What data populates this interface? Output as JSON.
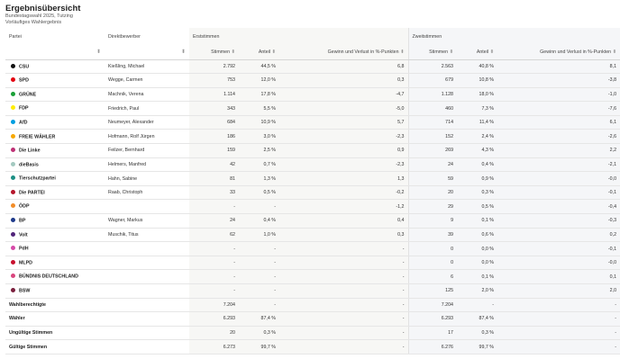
{
  "header": {
    "title": "Ergebnisübersicht",
    "subtitle": "Bundestagswahl 2025, Tutzing",
    "status": "Vorläufiges Wahlergebnis"
  },
  "columns": {
    "partei": "Partei",
    "direktbewerber": "Direktbewerber",
    "erststimmen": "Erststimmen",
    "zweitstimmen": "Zweitstimmen",
    "stimmen": "Stimmen",
    "anteil": "Anteil",
    "gewinn": "Gewinn und Verlust in %-Punkten"
  },
  "parties": [
    {
      "party": "CSU",
      "color": "#111111",
      "candidate": "Kießling, Michael",
      "e_votes": "2.792",
      "e_share": "44,5 %",
      "e_delta": "6,8",
      "z_votes": "2.563",
      "z_share": "40,8 %",
      "z_delta": "8,1"
    },
    {
      "party": "SPD",
      "color": "#e3000f",
      "candidate": "Wegge, Carmen",
      "e_votes": "753",
      "e_share": "12,0 %",
      "e_delta": "0,3",
      "z_votes": "679",
      "z_share": "10,8 %",
      "z_delta": "-3,8"
    },
    {
      "party": "GRÜNE",
      "color": "#1aa037",
      "candidate": "Machnik, Verena",
      "e_votes": "1.114",
      "e_share": "17,8 %",
      "e_delta": "-4,7",
      "z_votes": "1.128",
      "z_share": "18,0 %",
      "z_delta": "-1,0"
    },
    {
      "party": "FDP",
      "color": "#ffed00",
      "candidate": "Friedrich, Paul",
      "e_votes": "343",
      "e_share": "5,5 %",
      "e_delta": "-5,0",
      "z_votes": "460",
      "z_share": "7,3 %",
      "z_delta": "-7,6"
    },
    {
      "party": "AfD",
      "color": "#009ee0",
      "candidate": "Neumeyer, Alexander",
      "e_votes": "684",
      "e_share": "10,9 %",
      "e_delta": "5,7",
      "z_votes": "714",
      "z_share": "11,4 %",
      "z_delta": "6,1"
    },
    {
      "party": "FREIE WÄHLER",
      "color": "#f7a800",
      "candidate": "Hofmann, Rolf Jürgen",
      "e_votes": "186",
      "e_share": "3,0 %",
      "e_delta": "-2,3",
      "z_votes": "152",
      "z_share": "2,4 %",
      "z_delta": "-2,6"
    },
    {
      "party": "Die Linke",
      "color": "#be3075",
      "candidate": "Feilzer, Bernhard",
      "e_votes": "159",
      "e_share": "2,5 %",
      "e_delta": "0,9",
      "z_votes": "269",
      "z_share": "4,3 %",
      "z_delta": "2,2"
    },
    {
      "party": "dieBasis",
      "color": "#a3c9c0",
      "candidate": "Helmers, Manfred",
      "e_votes": "42",
      "e_share": "0,7 %",
      "e_delta": "-2,3",
      "z_votes": "24",
      "z_share": "0,4 %",
      "z_delta": "-2,1"
    },
    {
      "party": "Tierschutzpartei",
      "color": "#1c8f84",
      "candidate": "Hahn, Sabine",
      "e_votes": "81",
      "e_share": "1,3 %",
      "e_delta": "1,3",
      "z_votes": "59",
      "z_share": "0,9 %",
      "z_delta": "-0,0"
    },
    {
      "party": "Die PARTEI",
      "color": "#b5152b",
      "candidate": "Raab, Christoph",
      "e_votes": "33",
      "e_share": "0,5 %",
      "e_delta": "-0,2",
      "z_votes": "20",
      "z_share": "0,3 %",
      "z_delta": "-0,1"
    },
    {
      "party": "ÖDP",
      "color": "#f28c28",
      "candidate": "",
      "e_votes": "-",
      "e_share": "-",
      "e_delta": "-1,2",
      "z_votes": "29",
      "z_share": "0,5 %",
      "z_delta": "-0,4"
    },
    {
      "party": "BP",
      "color": "#1e3a8a",
      "candidate": "Wagner, Markus",
      "e_votes": "24",
      "e_share": "0,4 %",
      "e_delta": "0,4",
      "z_votes": "9",
      "z_share": "0,1 %",
      "z_delta": "-0,3"
    },
    {
      "party": "Volt",
      "color": "#502379",
      "candidate": "Muschik, Titus",
      "e_votes": "62",
      "e_share": "1,0 %",
      "e_delta": "0,3",
      "z_votes": "39",
      "z_share": "0,6 %",
      "z_delta": "0,2"
    },
    {
      "party": "PdH",
      "color": "#d64aa8",
      "candidate": "",
      "e_votes": "-",
      "e_share": "-",
      "e_delta": "-",
      "z_votes": "0",
      "z_share": "0,0 %",
      "z_delta": "-0,1"
    },
    {
      "party": "MLPD",
      "color": "#c8102e",
      "candidate": "",
      "e_votes": "-",
      "e_share": "-",
      "e_delta": "-",
      "z_votes": "0",
      "z_share": "0,0 %",
      "z_delta": "-0,0"
    },
    {
      "party": "BÜNDNIS DEUTSCHLAND",
      "color": "#d9467e",
      "candidate": "",
      "e_votes": "-",
      "e_share": "-",
      "e_delta": "-",
      "z_votes": "6",
      "z_share": "0,1 %",
      "z_delta": "0,1"
    },
    {
      "party": "BSW",
      "color": "#7a1f3d",
      "candidate": "",
      "e_votes": "-",
      "e_share": "-",
      "e_delta": "-",
      "z_votes": "125",
      "z_share": "2,0 %",
      "z_delta": "2,0"
    }
  ],
  "summary": [
    {
      "label": "Wahlberechtigte",
      "e_votes": "7.204",
      "e_share": "-",
      "e_delta": "-",
      "z_votes": "7.204",
      "z_share": "-",
      "z_delta": "-"
    },
    {
      "label": "Wähler",
      "e_votes": "6.293",
      "e_share": "87,4 %",
      "e_delta": "-",
      "z_votes": "6.293",
      "z_share": "87,4 %",
      "z_delta": "-"
    },
    {
      "label": "Ungültige Stimmen",
      "e_votes": "20",
      "e_share": "0,3 %",
      "e_delta": "-",
      "z_votes": "17",
      "z_share": "0,3 %",
      "z_delta": "-"
    },
    {
      "label": "Gültige Stimmen",
      "e_votes": "6.273",
      "e_share": "99,7 %",
      "e_delta": "-",
      "z_votes": "6.276",
      "z_share": "99,7 %",
      "z_delta": "-"
    }
  ]
}
